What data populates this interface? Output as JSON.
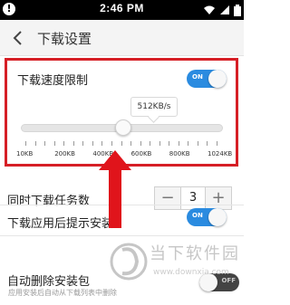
{
  "status_bar": {
    "time": "2:46 PM",
    "icons": [
      "warning-icon",
      "wifi-icon",
      "signal-icon",
      "battery-icon"
    ]
  },
  "title_bar": {
    "back_icon": "chevron-left-icon",
    "title": "下载设置"
  },
  "speed_limit": {
    "label": "下载速度限制",
    "toggle_state": "ON",
    "toggle_on": true,
    "slider": {
      "value_label": "512KB/s",
      "value_kb": 512,
      "min_kb": 10,
      "max_kb": 1024,
      "tick_labels": [
        "10KB",
        "200KB",
        "400KB",
        "600KB",
        "800KB",
        "1024KB"
      ]
    }
  },
  "concurrent_tasks": {
    "label": "同时下载任务数",
    "minus": "−",
    "value": "3",
    "plus": "+"
  },
  "notify_after_download": {
    "label": "下载应用后提示安装",
    "toggle_state": "ON",
    "toggle_on": true
  },
  "auto_delete": {
    "label": "自动删除安装包",
    "sublabel": "应用安装后自动从下载列表中删除",
    "toggle_state": "OFF",
    "toggle_on": false
  },
  "watermark": {
    "text": "当下软件园",
    "url": "www.downxia.com"
  },
  "colors": {
    "accent_blue": "#2a8be0",
    "highlight_red": "#d61f26",
    "status_bar": "#000000"
  }
}
